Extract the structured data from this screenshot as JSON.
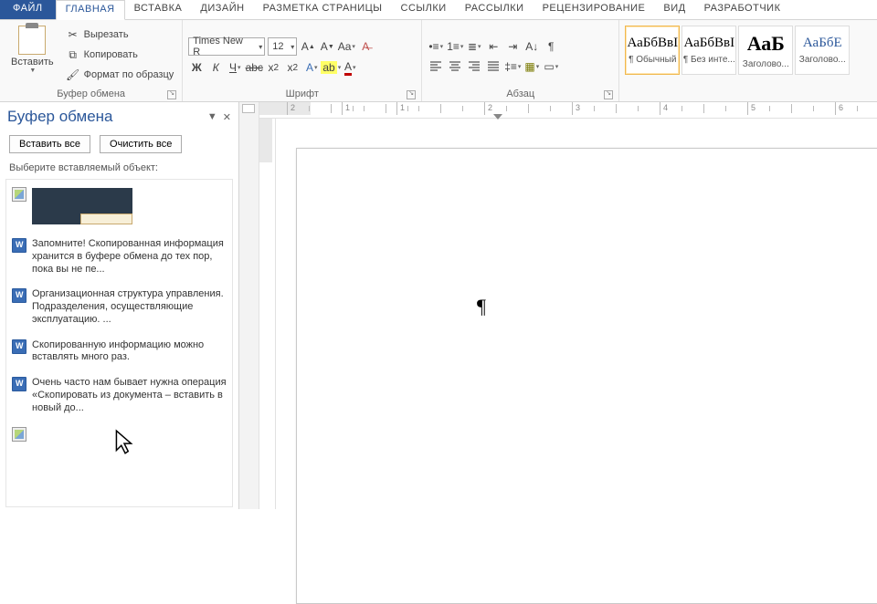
{
  "tabs": {
    "file": "ФАЙЛ",
    "items": [
      "ГЛАВНАЯ",
      "ВСТАВКА",
      "ДИЗАЙН",
      "РАЗМЕТКА СТРАНИЦЫ",
      "ССЫЛКИ",
      "РАССЫЛКИ",
      "РЕЦЕНЗИРОВАНИЕ",
      "ВИД",
      "РАЗРАБОТЧИК"
    ],
    "active": 0
  },
  "ribbon": {
    "clipboard": {
      "label": "Буфер обмена",
      "paste": "Вставить",
      "cut": "Вырезать",
      "copy": "Копировать",
      "format": "Формат по образцу"
    },
    "font": {
      "label": "Шрифт",
      "name": "Times New R",
      "size": "12"
    },
    "paragraph": {
      "label": "Абзац"
    },
    "styles": {
      "items": [
        {
          "preview": "АаБбВвІ",
          "name": "¶ Обычный"
        },
        {
          "preview": "АаБбВвІ",
          "name": "¶ Без инте..."
        },
        {
          "preview": "АаБ",
          "name": "Заголово..."
        },
        {
          "preview": "АаБбЕ",
          "name": "Заголово..."
        }
      ]
    }
  },
  "pane": {
    "title": "Буфер обмена",
    "paste_all": "Вставить все",
    "clear_all": "Очистить все",
    "hint": "Выберите вставляемый объект:",
    "clips": [
      {
        "type": "image",
        "text": ""
      },
      {
        "type": "word",
        "text": "Запомните! Скопированная информация хранится в буфере обмена до тех пор, пока вы не пе..."
      },
      {
        "type": "word",
        "text": "Организационная структура управления. Подразделения, осуществляющие эксплуатацию. ..."
      },
      {
        "type": "word",
        "text": "Скопированную информацию можно вставлять много раз."
      },
      {
        "type": "word",
        "text": "Очень часто нам бывает нужна операция «Скопировать из документа – вставить в новый до..."
      },
      {
        "type": "image",
        "text": ""
      }
    ]
  },
  "ruler": {
    "numbers": [
      2,
      1,
      1,
      2,
      3,
      4,
      5,
      6
    ]
  }
}
